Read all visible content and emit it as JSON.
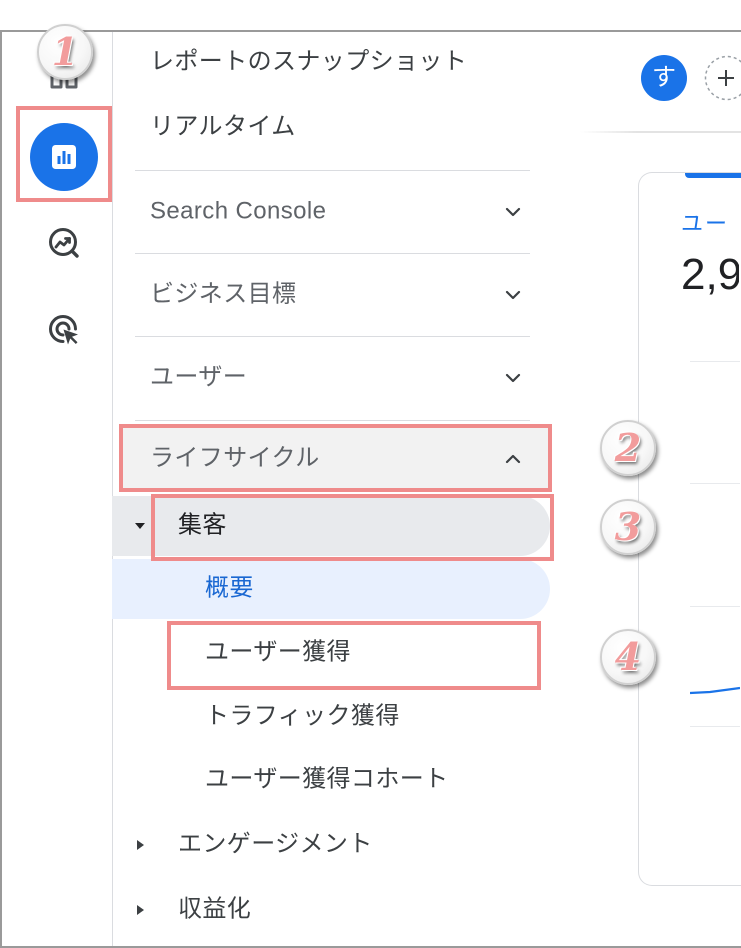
{
  "rail": {
    "items": [
      {
        "icon": "home-icon",
        "selected": false
      },
      {
        "icon": "reports-icon",
        "selected": true
      },
      {
        "icon": "explore-icon",
        "selected": false
      },
      {
        "icon": "advertising-icon",
        "selected": false
      }
    ]
  },
  "nav": {
    "snapshot": {
      "label": "レポートのスナップショット"
    },
    "realtime": {
      "label": "リアルタイム"
    },
    "sections": [
      {
        "label": "Search Console",
        "icon": "chevron-down-icon",
        "expanded": false
      },
      {
        "label": "ビジネス目標",
        "icon": "chevron-down-icon",
        "expanded": false
      },
      {
        "label": "ユーザー",
        "icon": "chevron-down-icon",
        "expanded": false
      },
      {
        "label": "ライフサイクル",
        "icon": "chevron-up-icon",
        "expanded": true
      }
    ],
    "lifecycle": {
      "groups": [
        {
          "label": "集客",
          "icon": "triangle-down-icon",
          "expanded": true,
          "children": [
            {
              "label": "概要",
              "selected": true
            },
            {
              "label": "ユーザー獲得",
              "selected": false
            },
            {
              "label": "トラフィック獲得",
              "selected": false
            },
            {
              "label": "ユーザー獲得コホート",
              "selected": false
            }
          ]
        },
        {
          "label": "エンゲージメント",
          "icon": "triangle-right-icon",
          "expanded": false
        },
        {
          "label": "収益化",
          "icon": "triangle-right-icon",
          "expanded": false
        }
      ]
    }
  },
  "header": {
    "avatar": {
      "initial": "す",
      "color": "#1a73e8"
    },
    "add_button": {
      "icon": "add-icon"
    }
  },
  "card": {
    "metric_label": "ユー",
    "metric_value": "2,9",
    "series_color": "#1a73e8"
  },
  "annotations": {
    "badges": [
      "1",
      "2",
      "3",
      "4"
    ],
    "highlight_color": "#ef8b8b"
  },
  "colors": {
    "accent": "#1a73e8",
    "selected_bg": "#e8f0fe",
    "selected_text": "#1967d2",
    "group_bg": "#e8eaed",
    "text_dark": "#3c4043",
    "text_muted": "#5f6368"
  }
}
